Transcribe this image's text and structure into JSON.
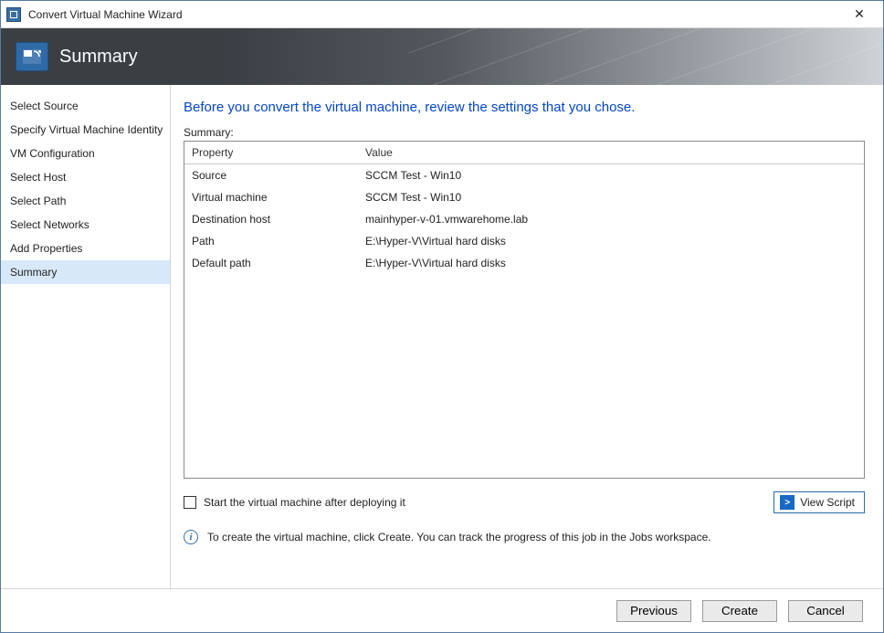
{
  "window": {
    "title": "Convert Virtual Machine Wizard"
  },
  "banner": {
    "title": "Summary"
  },
  "sidebar": {
    "items": [
      {
        "label": "Select Source",
        "selected": false
      },
      {
        "label": "Specify Virtual Machine Identity",
        "selected": false
      },
      {
        "label": "VM Configuration",
        "selected": false
      },
      {
        "label": "Select Host",
        "selected": false
      },
      {
        "label": "Select Path",
        "selected": false
      },
      {
        "label": "Select Networks",
        "selected": false
      },
      {
        "label": "Add Properties",
        "selected": false
      },
      {
        "label": "Summary",
        "selected": true
      }
    ]
  },
  "main": {
    "heading": "Before you convert the virtual machine, review the settings that you chose.",
    "summary_label": "Summary:",
    "grid": {
      "columns": {
        "property": "Property",
        "value": "Value"
      },
      "rows": [
        {
          "property": "Source",
          "value": "SCCM Test - Win10"
        },
        {
          "property": "Virtual machine",
          "value": "SCCM Test - Win10"
        },
        {
          "property": "Destination host",
          "value": "mainhyper-v-01.vmwarehome.lab"
        },
        {
          "property": "Path",
          "value": "E:\\Hyper-V\\Virtual hard disks"
        },
        {
          "property": "Default path",
          "value": "E:\\Hyper-V\\Virtual hard disks"
        }
      ]
    },
    "start_vm_label": "Start the virtual machine after deploying it",
    "view_script_label": "View Script",
    "info_text": "To create the virtual machine, click Create.  You can track the progress of this job in the Jobs workspace."
  },
  "footer": {
    "previous": "Previous",
    "create": "Create",
    "cancel": "Cancel"
  }
}
